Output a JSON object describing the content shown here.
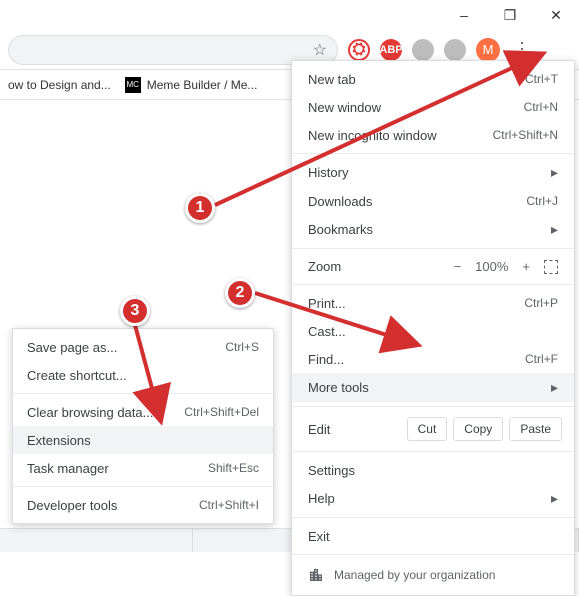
{
  "window": {
    "minimize": "–",
    "maximize": "❐",
    "close": "✕"
  },
  "toolbar": {
    "star": "☆",
    "ubo": "⛭",
    "abp": "ABP",
    "green": "",
    "grey": "",
    "avatar": "M",
    "kebab": "⋮"
  },
  "bookmarks": {
    "b1": "ow to Design and...",
    "b2_icon": "MC",
    "b2": "Meme Builder / Me..."
  },
  "menu": {
    "new_tab": "New tab",
    "new_tab_sc": "Ctrl+T",
    "new_window": "New window",
    "new_window_sc": "Ctrl+N",
    "incognito": "New incognito window",
    "incognito_sc": "Ctrl+Shift+N",
    "history": "History",
    "downloads": "Downloads",
    "downloads_sc": "Ctrl+J",
    "bookmarks": "Bookmarks",
    "zoom": "Zoom",
    "zoom_minus": "−",
    "zoom_val": "100%",
    "zoom_plus": "+",
    "print": "Print...",
    "print_sc": "Ctrl+P",
    "cast": "Cast...",
    "find": "Find...",
    "find_sc": "Ctrl+F",
    "more_tools": "More tools",
    "edit": "Edit",
    "cut": "Cut",
    "copy": "Copy",
    "paste": "Paste",
    "settings": "Settings",
    "help": "Help",
    "exit": "Exit",
    "managed": "Managed by your organization"
  },
  "submenu": {
    "save": "Save page as...",
    "save_sc": "Ctrl+S",
    "shortcut": "Create shortcut...",
    "clear": "Clear browsing data...",
    "clear_sc": "Ctrl+Shift+Del",
    "extensions": "Extensions",
    "task": "Task manager",
    "task_sc": "Shift+Esc",
    "dev": "Developer tools",
    "dev_sc": "Ctrl+Shift+I"
  },
  "annotations": {
    "b1": "1",
    "b2": "2",
    "b3": "3"
  }
}
